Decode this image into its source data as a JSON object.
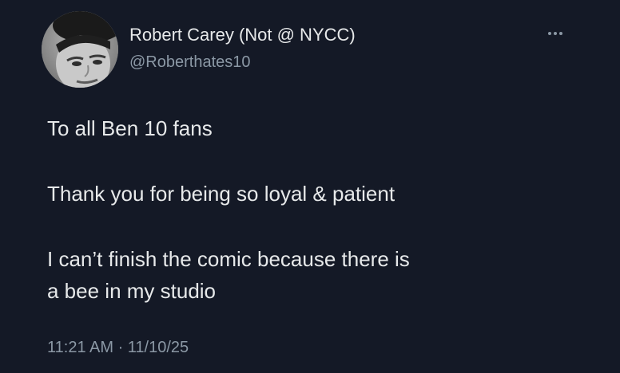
{
  "user": {
    "display_name": "Robert Carey (Not @ NYCC)",
    "handle": "@Roberthates10"
  },
  "tweet": {
    "line1": "To all Ben 10 fans",
    "line2": "Thank you for being so loyal & patient",
    "line3": "I can’t finish the comic because there is",
    "line4": "a bee in my studio",
    "timestamp": "11:21 AM · 11/10/25"
  },
  "icons": {
    "avatar": "profile-photo",
    "more": "more-horizontal-icon"
  },
  "colors": {
    "background": "#141926",
    "text_primary": "#e7e9ea",
    "text_secondary": "#8b98a5"
  }
}
